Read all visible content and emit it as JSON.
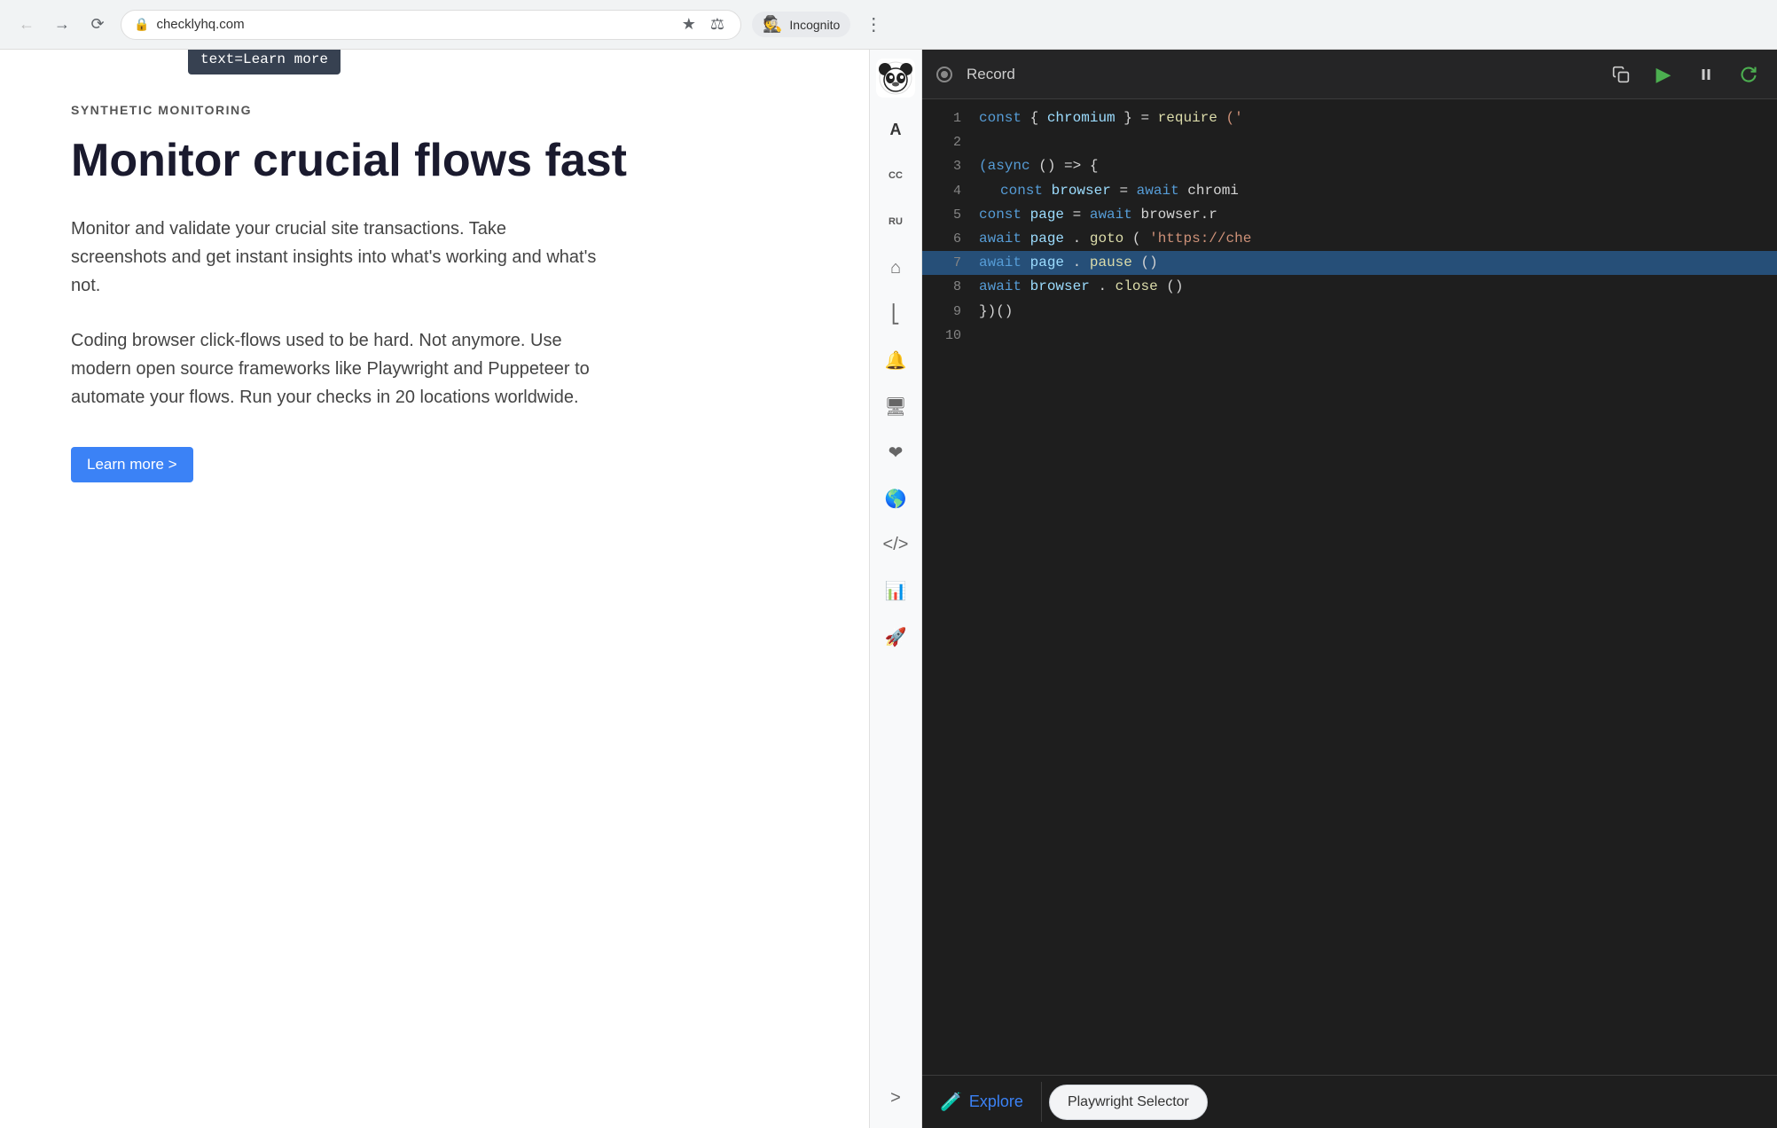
{
  "browser": {
    "url": "checklyhq.com",
    "incognito_label": "Incognito",
    "back_disabled": false,
    "forward_disabled": false
  },
  "webpage": {
    "synthetic_label": "SYNTHETIC MONITORING",
    "hero_title": "Monitor crucial flows fast",
    "hero_desc1": "Monitor and validate your crucial site transactions. Take screenshots and get instant insights into what's working and what's not.",
    "hero_desc2": "Coding browser click-flows used to be hard. Not anymore. Use modern open source frameworks like Playwright and Puppeteer to automate your flows. Run your checks in 20 locations worldwide.",
    "learn_more_btn": "Learn more >",
    "tooltip_text": "text=Learn more"
  },
  "code_editor": {
    "toolbar": {
      "record_label": "Record"
    },
    "lines": [
      {
        "num": 1,
        "content": "const { chromium } = require('"
      },
      {
        "num": 2,
        "content": ""
      },
      {
        "num": 3,
        "content": "(async () => {"
      },
      {
        "num": 4,
        "content": "  const browser = await chromi"
      },
      {
        "num": 5,
        "content": "  const page = await browser.r"
      },
      {
        "num": 6,
        "content": "  await page.goto('https://che"
      },
      {
        "num": 7,
        "content": "  await page.pause()",
        "highlighted": true
      },
      {
        "num": 8,
        "content": "  await browser.close()"
      },
      {
        "num": 9,
        "content": "})()"
      },
      {
        "num": 10,
        "content": ""
      }
    ],
    "bottom": {
      "explore_label": "Explore",
      "playwright_selector_label": "Playwright Selector"
    }
  },
  "sidebar": {
    "icons": [
      "home",
      "activity",
      "bell",
      "monitor",
      "heart",
      "globe",
      "code",
      "chart",
      "rocket"
    ]
  }
}
